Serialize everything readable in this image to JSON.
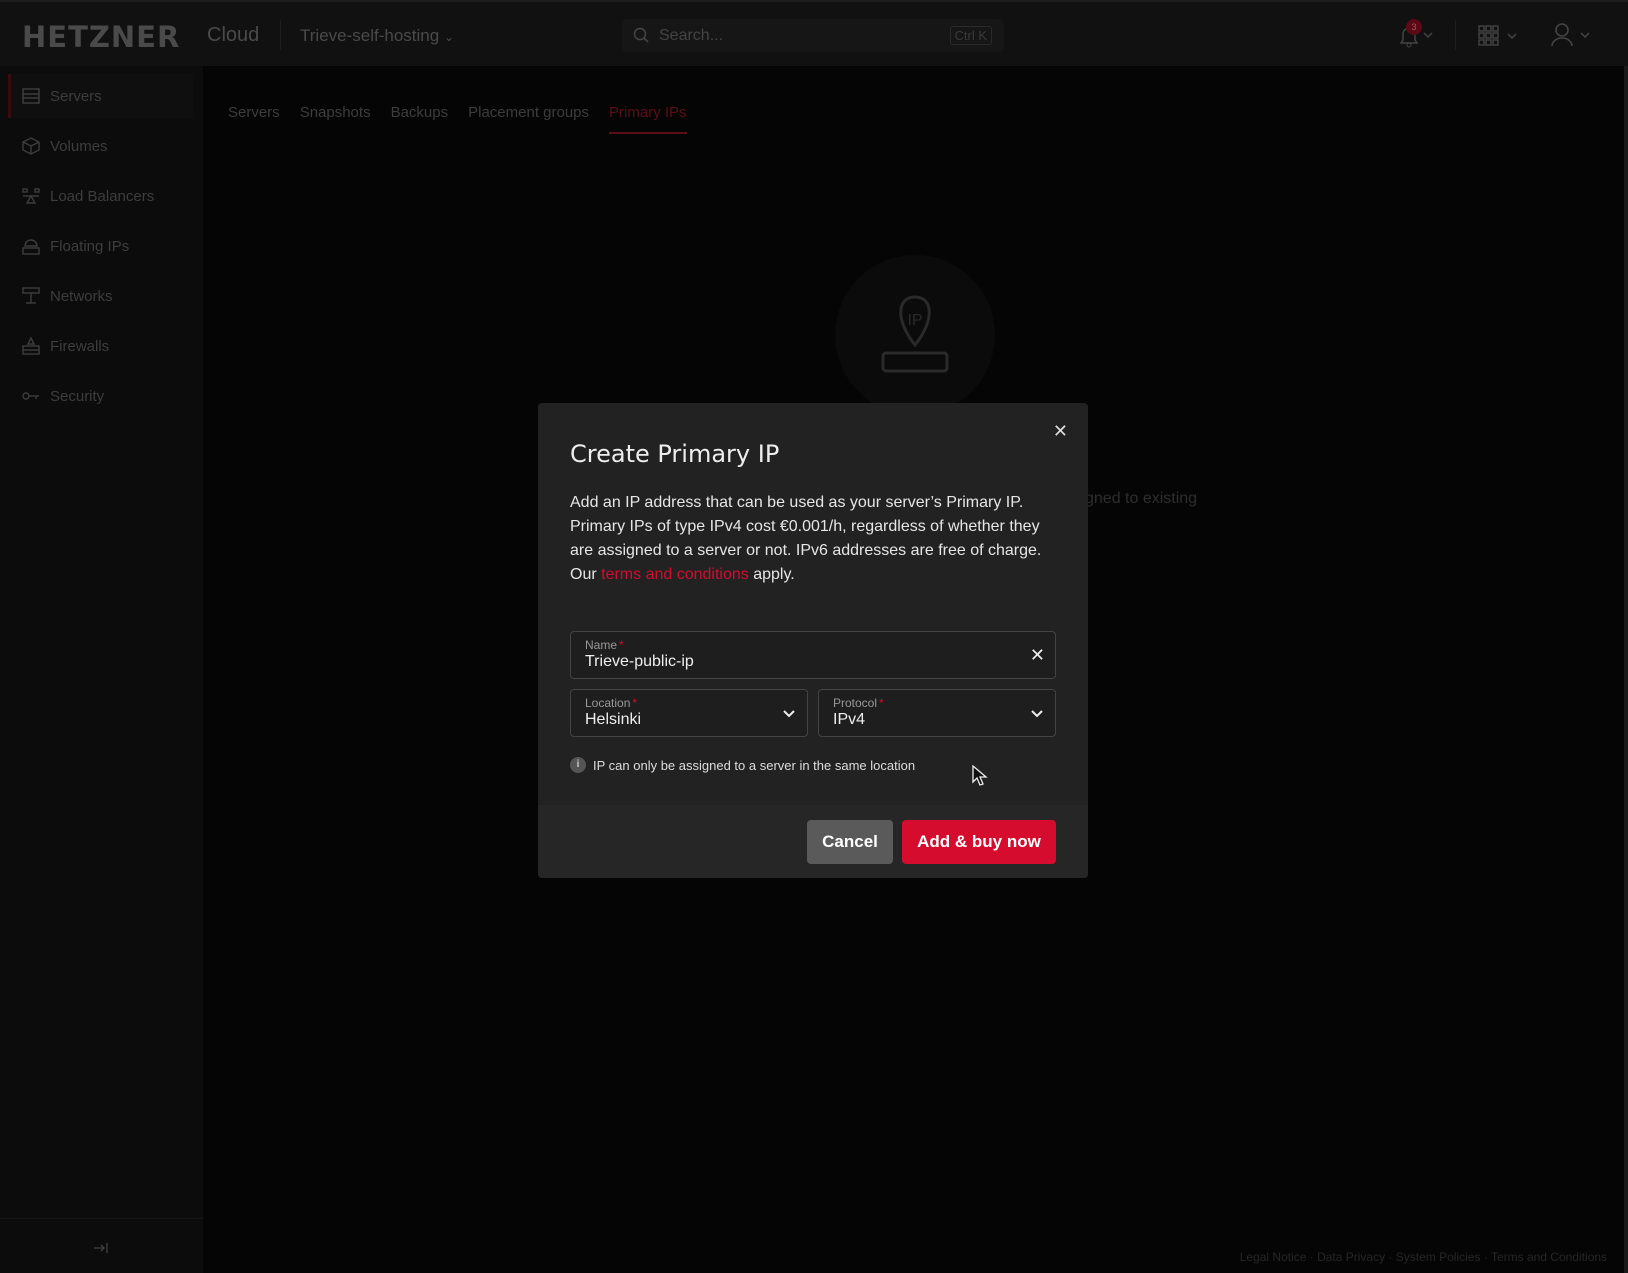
{
  "header": {
    "logo": "HETZNER",
    "logo_suffix": "Cloud",
    "project": "Trieve-self-hosting",
    "search_placeholder": "Search...",
    "search_shortcut": "Ctrl K",
    "notification_count": "3"
  },
  "sidebar": {
    "items": [
      {
        "label": "Servers",
        "icon": "server-icon",
        "active": true
      },
      {
        "label": "Volumes",
        "icon": "cube-icon"
      },
      {
        "label": "Load Balancers",
        "icon": "load-balancer-icon"
      },
      {
        "label": "Floating IPs",
        "icon": "cloud-icon"
      },
      {
        "label": "Networks",
        "icon": "network-icon"
      },
      {
        "label": "Firewalls",
        "icon": "firewall-icon"
      },
      {
        "label": "Security",
        "icon": "key-icon"
      }
    ]
  },
  "tabs": [
    {
      "label": "Servers"
    },
    {
      "label": "Snapshots"
    },
    {
      "label": "Backups"
    },
    {
      "label": "Placement groups"
    },
    {
      "label": "Primary IPs",
      "active": true
    }
  ],
  "empty_state": {
    "text_fragment": "gned to existing"
  },
  "modal": {
    "title": "Create Primary IP",
    "body": "Add an IP address that can be used as your server’s Primary IP. Primary IPs of type IPv4 cost €0.001/h, regardless of whether they are assigned to a server or not. IPv6 addresses are free of charge.",
    "terms_prefix": "Our ",
    "terms_link": "terms and conditions",
    "terms_suffix": " apply.",
    "name": {
      "label": "Name",
      "required": "*",
      "value": "Trieve-public-ip"
    },
    "location": {
      "label": "Location",
      "required": "*",
      "value": "Helsinki"
    },
    "protocol": {
      "label": "Protocol",
      "required": "*",
      "value": "IPv4"
    },
    "info": "IP can only be assigned to a server in the same location",
    "cancel": "Cancel",
    "submit": "Add & buy now"
  },
  "footer": {
    "links": [
      "Legal Notice",
      "Data Privacy",
      "System Policies",
      "Terms and Conditions"
    ]
  },
  "colors": {
    "accent": "#d50c2d",
    "modal_bg": "#222222",
    "cancel_bg": "#5a5a5a"
  }
}
